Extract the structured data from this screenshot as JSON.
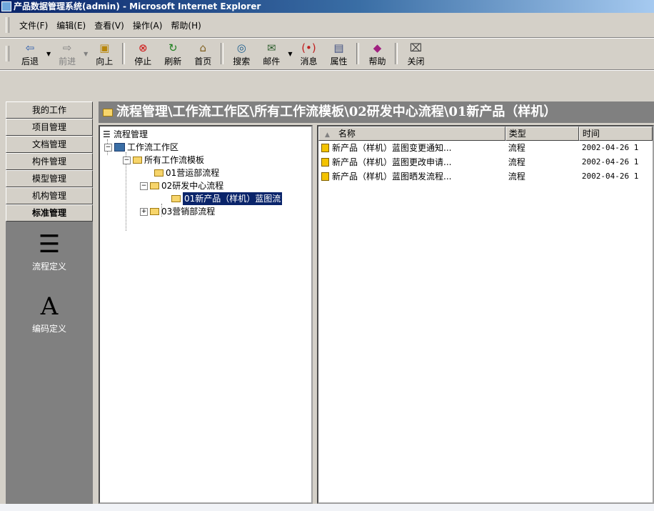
{
  "window": {
    "title": "产品数据管理系统(admin) - Microsoft Internet Explorer"
  },
  "menu": [
    "文件(F)",
    "编辑(E)",
    "查看(V)",
    "操作(A)",
    "帮助(H)"
  ],
  "toolbar": {
    "back": "后退",
    "forward": "前进",
    "up": "向上",
    "stop": "停止",
    "refresh": "刷新",
    "home": "首页",
    "search": "搜索",
    "mail": "邮件",
    "message": "消息",
    "properties": "属性",
    "help": "帮助",
    "close": "关闭"
  },
  "sidebar": {
    "items": [
      "我的工作",
      "项目管理",
      "文档管理",
      "构件管理",
      "模型管理",
      "机构管理",
      "标准管理"
    ],
    "tools": [
      {
        "glyph": "☰",
        "label": "流程定义"
      },
      {
        "glyph": "A",
        "label": "编码定义"
      }
    ]
  },
  "path": "流程管理\\工作流工作区\\所有工作流模板\\02研发中心流程\\01新产品（样机）",
  "tree": {
    "root": "流程管理",
    "workspace": "工作流工作区",
    "templates": "所有工作流模板",
    "ops": "01营运部流程",
    "rd": "02研发中心流程",
    "rd_child": "01新产品（样机）蓝图流",
    "marketing": "03营销部流程"
  },
  "list": {
    "columns": [
      "名称",
      "类型",
      "时间"
    ],
    "rows": [
      {
        "name": "新产品（样机）蓝图变更通知...",
        "type": "流程",
        "time": "2002-04-26 1"
      },
      {
        "name": "新产品（样机）蓝图更改申请...",
        "type": "流程",
        "time": "2002-04-26 1"
      },
      {
        "name": "新产品（样机）蓝图晒发流程...",
        "type": "流程",
        "time": "2002-04-26 1"
      }
    ]
  }
}
